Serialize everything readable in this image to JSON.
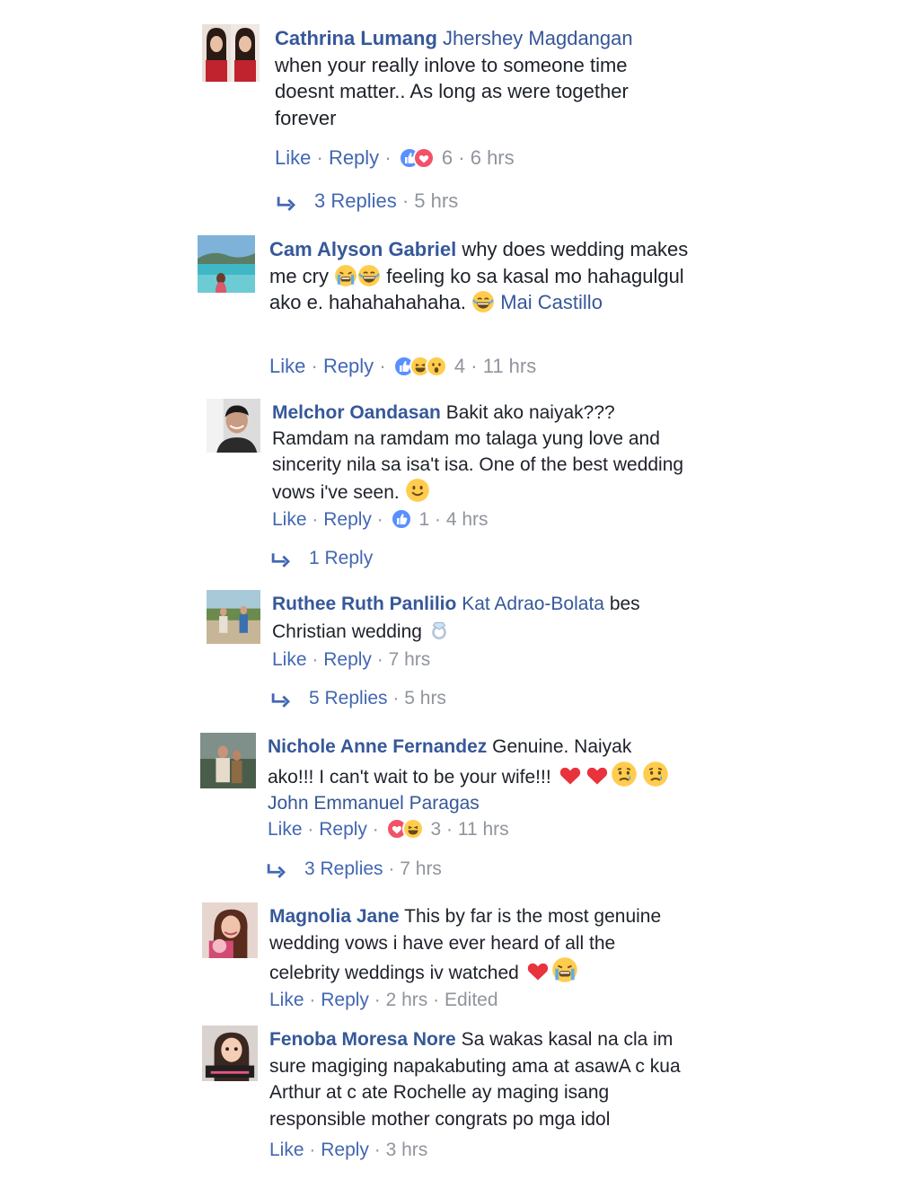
{
  "comments": [
    {
      "name": "Cathrina Lumang",
      "tag": "Jhershey Magdangan",
      "text": "when your really inlove to someone time doesnt matter.. As long as were together forever",
      "like": "Like",
      "reply": "Reply",
      "reaction_count": "6",
      "time": "6 hrs",
      "replies_label": "3 Replies",
      "replies_time": "5 hrs",
      "reactions": [
        "like-reaction-icon",
        "love-reaction-icon"
      ]
    },
    {
      "name": "Cam Alyson Gabriel",
      "text_a": "why does wedding makes me cry",
      "text_b": "feeling ko sa kasal mo hahagulgul ako e. hahahahahaha.",
      "tag": "Mai Castillo",
      "like": "Like",
      "reply": "Reply",
      "reaction_count": "4",
      "time": "11 hrs",
      "reactions": [
        "like-reaction-icon",
        "haha-reaction-icon",
        "wow-reaction-icon"
      ]
    },
    {
      "name": "Melchor Oandasan",
      "text": "Bakit ako naiyak??? Ramdam na ramdam mo talaga yung love and sincerity nila sa isa't isa. One of the best wedding vows i've seen.",
      "like": "Like",
      "reply": "Reply",
      "reaction_count": "1",
      "time": "4 hrs",
      "replies_label": "1 Reply",
      "reactions": [
        "like-reaction-icon"
      ]
    },
    {
      "name": "Ruthee Ruth Panlilio",
      "tag": "Kat Adrao-Bolata",
      "text": "bes Christian wedding",
      "like": "Like",
      "reply": "Reply",
      "time": "7 hrs",
      "replies_label": "5 Replies",
      "replies_time": "5 hrs"
    },
    {
      "name": "Nichole Anne Fernandez",
      "text": "Genuine. Naiyak ako!!! I can't wait to be your wife!!!",
      "tag": "John Emmanuel Paragas",
      "like": "Like",
      "reply": "Reply",
      "reaction_count": "3",
      "time": "11 hrs",
      "replies_label": "3 Replies",
      "replies_time": "7 hrs",
      "reactions": [
        "love-reaction-icon",
        "haha-reaction-icon"
      ]
    },
    {
      "name": "Magnolia Jane",
      "text": "This by far is the most genuine wedding vows i have ever heard of all the celebrity weddings iv watched",
      "like": "Like",
      "reply": "Reply",
      "time": "2 hrs",
      "edited": "Edited"
    },
    {
      "name": "Fenoba Moresa Nore",
      "text": "Sa wakas kasal na cla im sure magiging napakabuting ama at asawA c kua Arthur at c ate Rochelle ay maging isang responsible mother congrats po mga idol",
      "like": "Like",
      "reply": "Reply",
      "time": "3 hrs"
    }
  ],
  "colors": {
    "name": "#365899",
    "link": "#4267b2",
    "meta": "#90949c",
    "text": "#1d2129",
    "like_blue": "#5890ff",
    "love_red": "#f25268",
    "emoji_yellow": "#ffcc4d"
  },
  "separator": "·"
}
